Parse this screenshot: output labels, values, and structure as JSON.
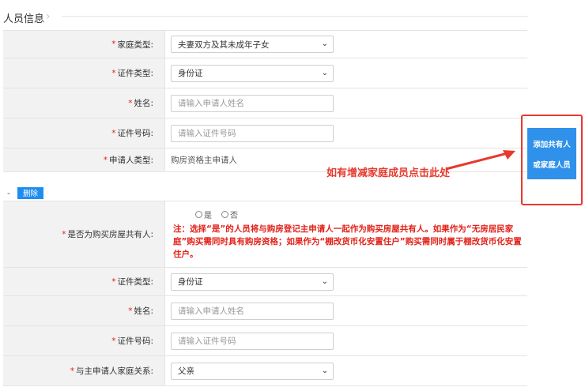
{
  "section": {
    "title": "人员信息",
    "chevron": "›"
  },
  "applicant": {
    "family_type": {
      "label": "家庭类型:",
      "value": "夫妻双方及其未成年子女"
    },
    "id_type": {
      "label": "证件类型:",
      "value": "身份证"
    },
    "name": {
      "label": "姓名:",
      "placeholder": "请输入申请人姓名"
    },
    "id_number": {
      "label": "证件号码:",
      "placeholder": "请输入证件号码"
    },
    "applicant_type": {
      "label": "申请人类型:",
      "value": "购房资格主申请人"
    }
  },
  "member": {
    "minus": "-",
    "delete_label": "删除",
    "co_owner": {
      "label": "是否为购买房屋共有人:",
      "options": [
        "是",
        "否"
      ],
      "note": "注：选择“是”的人员将与购房登记主申请人一起作为购买房屋共有人。如果作为“无房居民家庭”购买需同时具有购房资格；如果作为“棚改货币化安置住户”购买需同时属于棚改货币化安置住户。"
    },
    "id_type": {
      "label": "证件类型:",
      "value": "身份证"
    },
    "name": {
      "label": "姓名:",
      "placeholder": "请输入申请人姓名"
    },
    "id_number": {
      "label": "证件号码:",
      "placeholder": "请输入证件号码"
    },
    "relation": {
      "label": "与主申请人家庭关系:",
      "value": "父亲"
    }
  },
  "add_button": {
    "line1": "添加共有人",
    "line2": "或家庭人员"
  },
  "annotation": "如有增减家庭成员点击此处",
  "required_mark": "*",
  "caret": "⌄"
}
